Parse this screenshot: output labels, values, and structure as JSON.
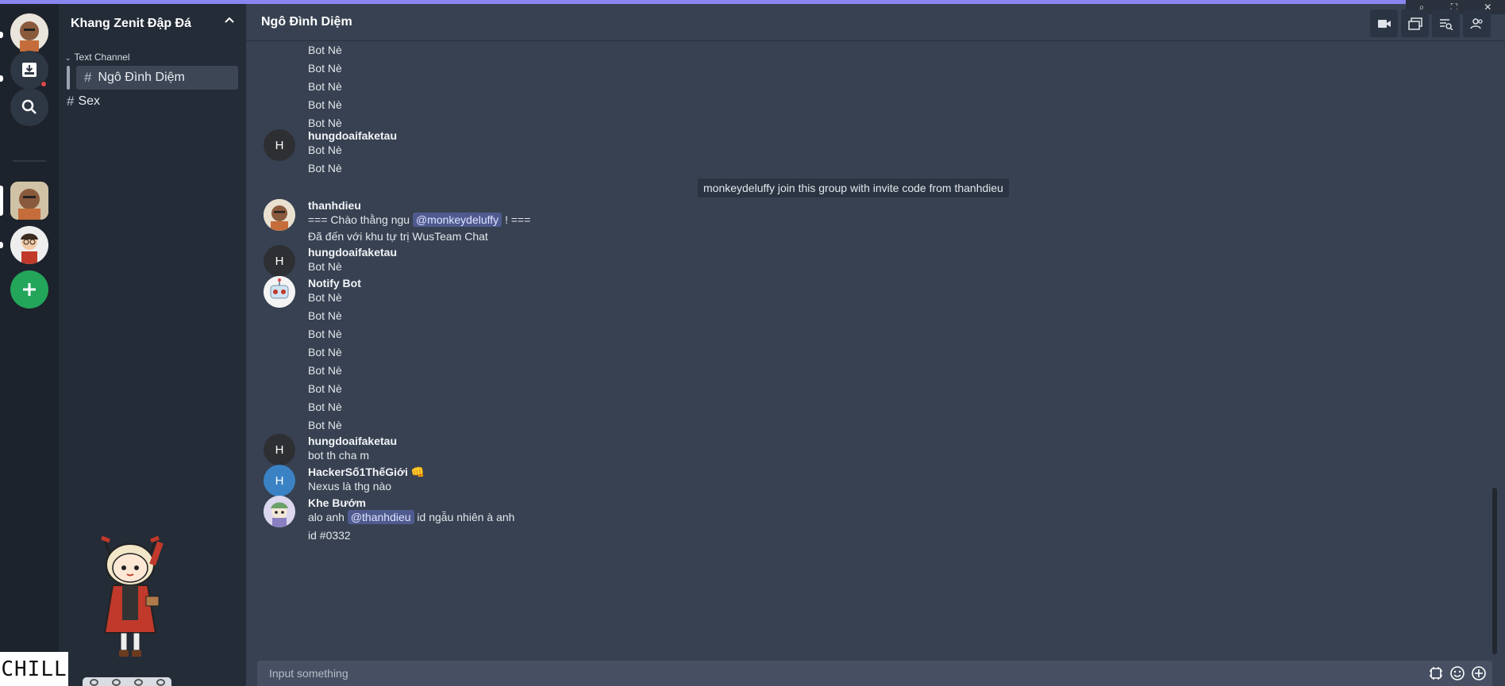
{
  "accent": "#8a86f0",
  "servers": {
    "items": [
      {
        "name": "user-avatar",
        "type": "avatar"
      },
      {
        "name": "inbox-icon",
        "type": "icon"
      },
      {
        "name": "search-icon",
        "type": "icon"
      },
      {
        "name": "server-avatar-1",
        "type": "avatar",
        "active": true
      },
      {
        "name": "server-avatar-2",
        "type": "avatar"
      },
      {
        "name": "add-server-icon",
        "type": "icon",
        "color": "#23a55a"
      }
    ]
  },
  "guild": {
    "title": "Khang Zenit Đập Đá",
    "category": "Text Channel",
    "channels": [
      {
        "label": "Ngô Đình Diệm",
        "active": true
      },
      {
        "label": "Sex",
        "active": false
      }
    ],
    "sticker_text": "CHILL"
  },
  "header": {
    "title": "Ngô Đình Diệm",
    "icons": [
      "video-icon",
      "threads-icon",
      "search-list-icon",
      "members-icon"
    ]
  },
  "messages": {
    "rows": [
      {
        "text": "Bot Nè"
      },
      {
        "text": "Bot Nè"
      },
      {
        "text": "Bot Nè"
      },
      {
        "text": "Bot Nè"
      },
      {
        "text": "Bot Nè"
      },
      {
        "author": "hungdoaifaketau",
        "avatar_letter": "H",
        "text": "Bot Nè"
      },
      {
        "text": "Bot Nè"
      },
      {
        "system": "monkeydeluffy join this group with invite code from thanhdieu"
      },
      {
        "author": "thanhdieu",
        "text_before": "=== Chào thằng ngu ",
        "mention": "@monkeydeluffy",
        "text_after": " ! ==="
      },
      {
        "text": "Đã đến với khu tự trị WusTeam Chat"
      },
      {
        "author": "hungdoaifaketau",
        "avatar_letter": "H",
        "text": "Bot Nè"
      },
      {
        "author": "Notify Bot",
        "text": "Bot Nè"
      },
      {
        "text": "Bot Nè"
      },
      {
        "text": "Bot Nè"
      },
      {
        "text": "Bot Nè"
      },
      {
        "text": "Bot Nè"
      },
      {
        "text": "Bot Nè"
      },
      {
        "text": "Bot Nè"
      },
      {
        "text": "Bot Nè"
      },
      {
        "author": "hungdoaifaketau",
        "avatar_letter": "H",
        "text": "bot th cha m"
      },
      {
        "author": "HackerSố1ThếGiới",
        "author_emoji": "👊",
        "avatar_letter": "H",
        "avatar_color": "#3b82c4",
        "text": "Nexus là thg nào"
      },
      {
        "author": "Khe Bướm",
        "text_before": "alo anh ",
        "mention": "@thanhdieu",
        "text_after": " id ngẫu nhiên à anh"
      },
      {
        "text": "id #0332"
      }
    ]
  },
  "composer": {
    "placeholder": "Input something",
    "icons": [
      "sticker-icon",
      "emoji-icon",
      "add-icon"
    ]
  }
}
